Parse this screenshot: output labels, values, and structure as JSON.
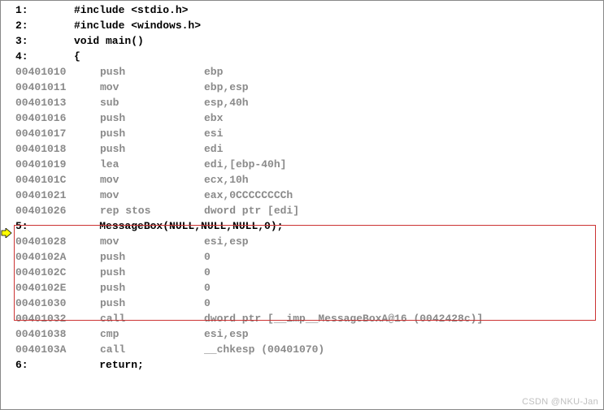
{
  "source_lines": [
    {
      "no": "1:",
      "text": "#include <stdio.h>"
    },
    {
      "no": "2:",
      "text": "#include <windows.h>"
    },
    {
      "no": "3:",
      "text": "void main()"
    },
    {
      "no": "4:",
      "text": "{"
    }
  ],
  "asm_block_1": [
    {
      "addr": "00401010",
      "mn": "push",
      "op": "ebp"
    },
    {
      "addr": "00401011",
      "mn": "mov",
      "op": "ebp,esp"
    },
    {
      "addr": "00401013",
      "mn": "sub",
      "op": "esp,40h"
    },
    {
      "addr": "00401016",
      "mn": "push",
      "op": "ebx"
    },
    {
      "addr": "00401017",
      "mn": "push",
      "op": "esi"
    },
    {
      "addr": "00401018",
      "mn": "push",
      "op": "edi"
    },
    {
      "addr": "00401019",
      "mn": "lea",
      "op": "edi,[ebp-40h]"
    },
    {
      "addr": "0040101C",
      "mn": "mov",
      "op": "ecx,10h"
    },
    {
      "addr": "00401021",
      "mn": "mov",
      "op": "eax,0CCCCCCCCh"
    },
    {
      "addr": "00401026",
      "mn": "rep stos",
      "op": "dword ptr [edi]"
    }
  ],
  "source_line_5": {
    "no": "5:",
    "text": "MessageBox(NULL,NULL,NULL,0);"
  },
  "asm_block_highlight": [
    {
      "addr": "00401028",
      "mn": "mov",
      "op": "esi,esp"
    },
    {
      "addr": "0040102A",
      "mn": "push",
      "op": "0"
    },
    {
      "addr": "0040102C",
      "mn": "push",
      "op": "0"
    },
    {
      "addr": "0040102E",
      "mn": "push",
      "op": "0"
    },
    {
      "addr": "00401030",
      "mn": "push",
      "op": "0"
    },
    {
      "addr": "00401032",
      "mn": "call",
      "op": "dword ptr [__imp__MessageBoxA@16 (0042428c)]"
    }
  ],
  "asm_block_2": [
    {
      "addr": "00401038",
      "mn": "cmp",
      "op": "esi,esp"
    },
    {
      "addr": "0040103A",
      "mn": "call",
      "op": "__chkesp (00401070)"
    }
  ],
  "source_line_6": {
    "no": "6:",
    "text": "return;"
  },
  "watermark": "CSDN @NKU-Jan"
}
